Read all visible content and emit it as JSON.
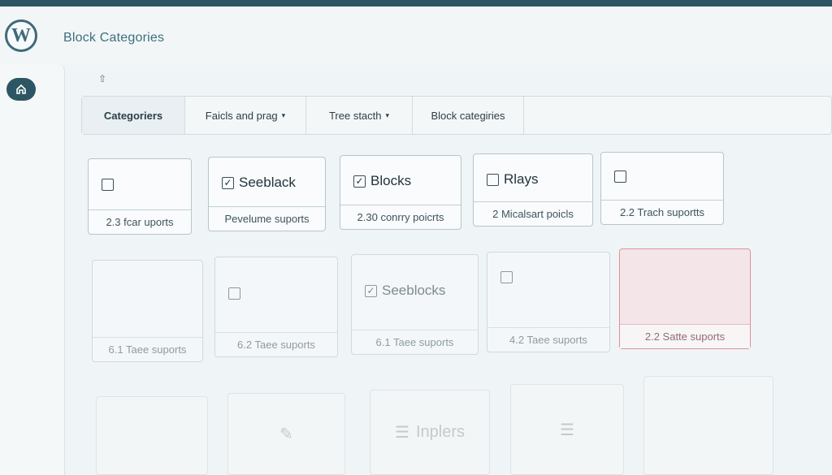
{
  "header": {
    "title": "Block Categories",
    "logo_text": "W"
  },
  "tabs": [
    {
      "label": "Categoriers",
      "has_caret": false
    },
    {
      "label": "Faicls and prag",
      "has_caret": true
    },
    {
      "label": "Tree stacth",
      "has_caret": true
    },
    {
      "label": "Block categiries",
      "has_caret": false
    }
  ],
  "caret_glyph": "▾",
  "rows": [
    [
      {
        "checkbox": "unchecked",
        "title": "",
        "footer": "2.3 fcar uports"
      },
      {
        "checkbox": "checked",
        "title": "Seeblack",
        "footer": "Pevelume suports"
      },
      {
        "checkbox": "checked",
        "title": "Blocks",
        "footer": "2.30 conrry poicrts"
      },
      {
        "checkbox": "unchecked",
        "title": "Rlays",
        "footer": "2 Micalsart poicls"
      },
      {
        "checkbox": "unchecked",
        "title": "",
        "footer": "2.2 Trach suportts"
      }
    ],
    [
      {
        "checkbox": "none",
        "title": "",
        "footer": "6.1 Taee suports"
      },
      {
        "checkbox": "unchecked",
        "title": "",
        "footer": "6.2 Taee suports"
      },
      {
        "checkbox": "checked",
        "title": "Seeblocks",
        "footer": "6.1 Taee suports"
      },
      {
        "checkbox": "unchecked",
        "title": "",
        "footer": "4.2 Taee suports"
      },
      {
        "checkbox": "none",
        "title": "",
        "footer": "2.2 Satte suports",
        "highlight": "#d97a86"
      }
    ],
    [
      {
        "icon": "",
        "title": ""
      },
      {
        "icon": "pencil-icon",
        "title": ""
      },
      {
        "icon": "list-icon",
        "title": "Inplers"
      },
      {
        "icon": "list-icon",
        "title": ""
      },
      {
        "icon": "",
        "title": ""
      }
    ]
  ],
  "colors": {
    "topbar": "#2f5462",
    "accent": "#3c6f80",
    "home_button": "#2c5664",
    "highlight": "#d97a86"
  }
}
